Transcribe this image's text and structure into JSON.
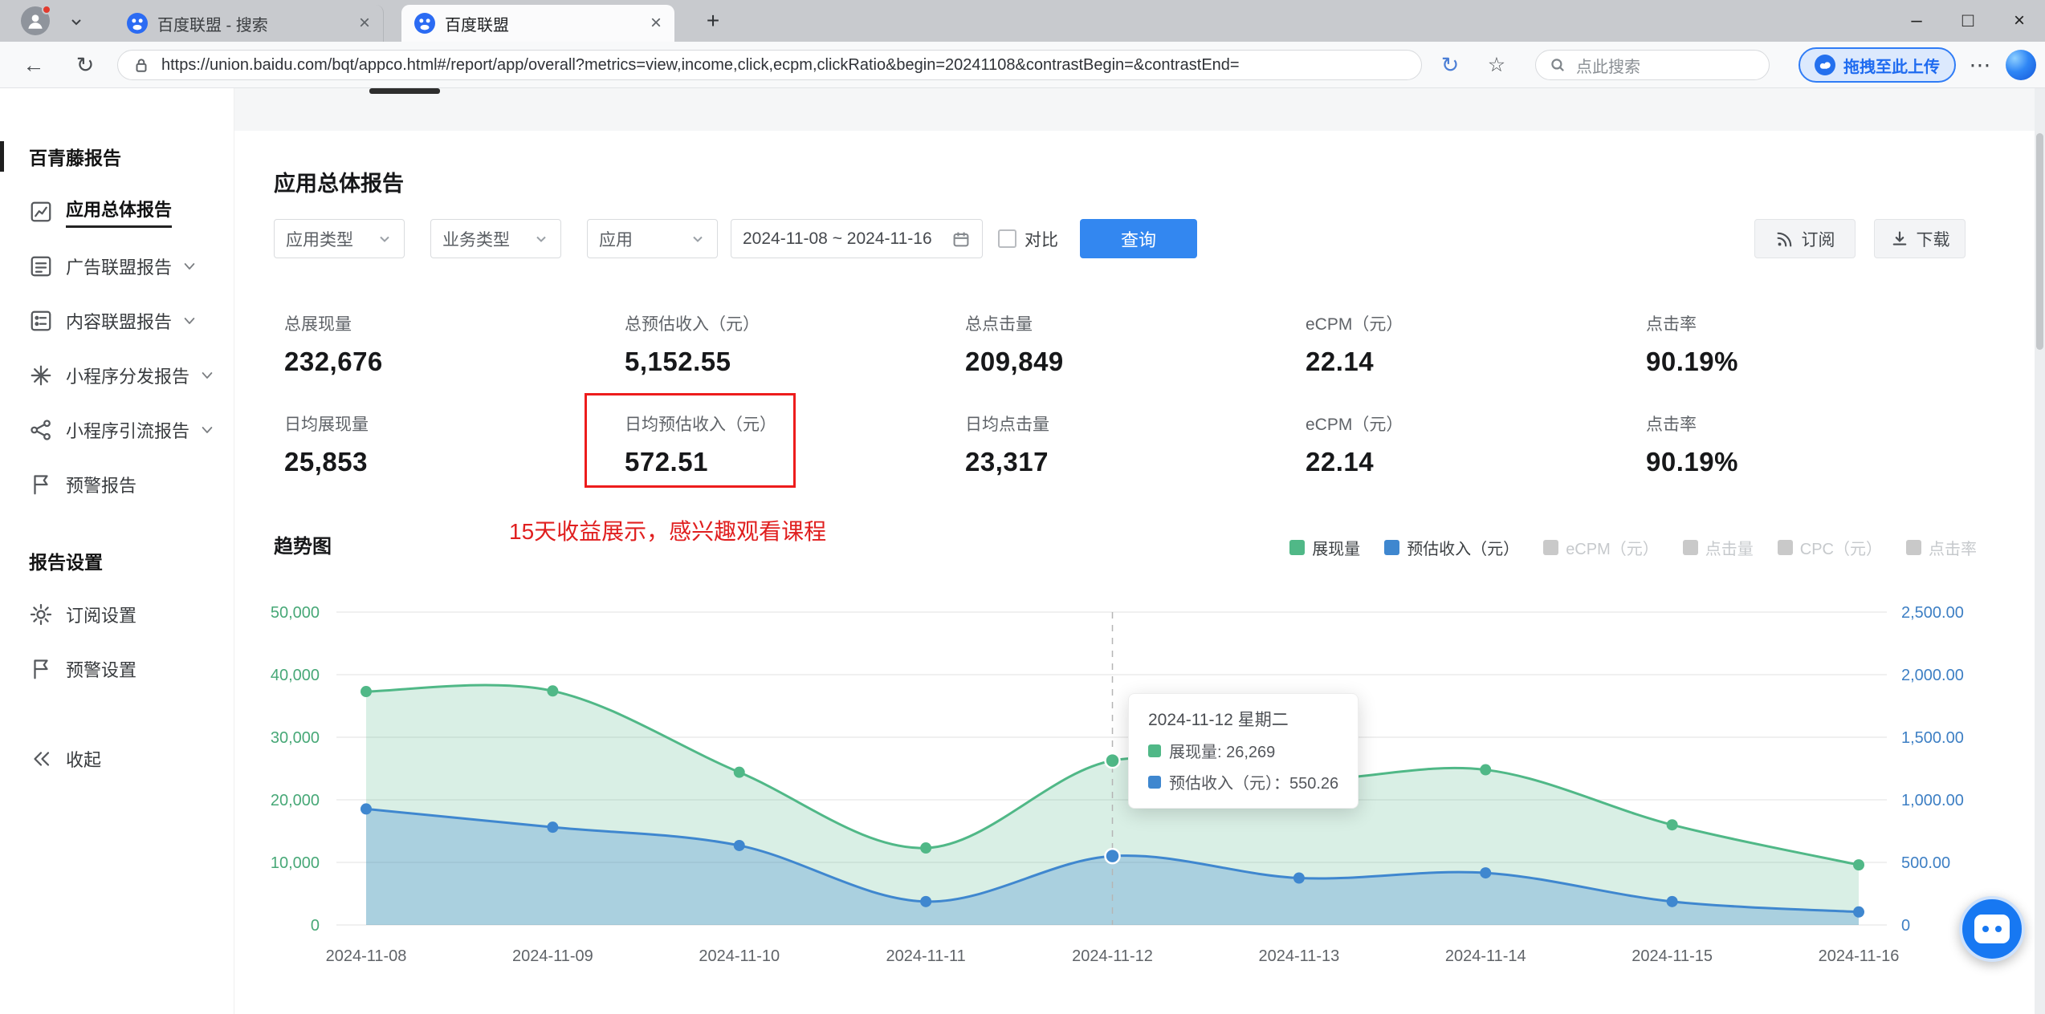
{
  "colors": {
    "accent_blue": "#3387f0",
    "highlight_red": "#ed1c1c",
    "series_green": "#50b887",
    "series_blue": "#3f87cf",
    "axis_green": "#47a877",
    "axis_blue": "#3d7fc4",
    "legend_inactive": "#c9c9c9"
  },
  "icons": {
    "back_arrow": "←",
    "refresh": "↻",
    "page_action": "↻",
    "star": "☆",
    "more_dots": "⋯",
    "new_tab": "+",
    "tab_close": "×",
    "window_minimize": "–",
    "window_maximize": "□",
    "window_close": "×"
  },
  "browser": {
    "tabs": [
      {
        "title": "百度联盟 - 搜索",
        "active": false
      },
      {
        "title": "百度联盟",
        "active": true
      }
    ],
    "url": "https://union.baidu.com/bqt/appco.html#/report/app/overall?metrics=view,income,click,ecpm,clickRatio&begin=20241108&contrastBegin=&contrastEnd=",
    "search_placeholder": "点此搜索",
    "upload_button_label": "拖拽至此上传"
  },
  "sidebar": {
    "section1_title": "百青藤报告",
    "menu": [
      {
        "id": "overall-report",
        "label": "应用总体报告",
        "icon": "report-chart",
        "active": true,
        "expandable": false
      },
      {
        "id": "ad-union-report",
        "label": "广告联盟报告",
        "icon": "ad-doc",
        "active": false,
        "expandable": true
      },
      {
        "id": "content-union-report",
        "label": "内容联盟报告",
        "icon": "content-doc",
        "active": false,
        "expandable": true
      },
      {
        "id": "miniapp-distribution-report",
        "label": "小程序分发报告",
        "icon": "grid-burst",
        "active": false,
        "expandable": true
      },
      {
        "id": "miniapp-referral-report",
        "label": "小程序引流报告",
        "icon": "share-nodes",
        "active": false,
        "expandable": true
      },
      {
        "id": "alert-report",
        "label": "预警报告",
        "icon": "flag-doc",
        "active": false,
        "expandable": false
      }
    ],
    "section2_title": "报告设置",
    "settings_menu": [
      {
        "id": "subscribe-settings",
        "label": "订阅设置",
        "icon": "gear"
      },
      {
        "id": "alert-settings",
        "label": "预警设置",
        "icon": "flag-doc"
      }
    ],
    "collapse_label": "收起"
  },
  "main": {
    "title": "应用总体报告",
    "filters": {
      "app_type": "应用类型",
      "business_type": "业务类型",
      "app": "应用",
      "date_range": "2024-11-08 ~ 2024-11-16",
      "compare_label": "对比",
      "query_button": "查询",
      "subscribe_button": "订阅",
      "download_button": "下载"
    },
    "stats_row1": [
      {
        "label": "总展现量",
        "value": "232,676"
      },
      {
        "label": "总预估收入（元）",
        "value": "5,152.55"
      },
      {
        "label": "总点击量",
        "value": "209,849"
      },
      {
        "label": "eCPM（元）",
        "value": "22.14"
      },
      {
        "label": "点击率",
        "value": "90.19%"
      }
    ],
    "stats_row2": [
      {
        "label": "日均展现量",
        "value": "25,853"
      },
      {
        "label": "日均预估收入（元）",
        "value": "572.51",
        "highlighted": true
      },
      {
        "label": "日均点击量",
        "value": "23,317"
      },
      {
        "label": "eCPM（元）",
        "value": "22.14"
      },
      {
        "label": "点击率",
        "value": "90.19%"
      }
    ],
    "annotation": "15天收益展示，感兴趣观看课程",
    "chart_title": "趋势图"
  },
  "chart_data": {
    "type": "area",
    "title": "趋势图",
    "x": [
      "2024-11-08",
      "2024-11-09",
      "2024-11-10",
      "2024-11-11",
      "2024-11-12",
      "2024-11-13",
      "2024-11-14",
      "2024-11-15",
      "2024-11-16"
    ],
    "series": [
      {
        "name": "展现量",
        "axis": "left",
        "color": "#50b887",
        "fill": "rgba(80,184,135,0.22)",
        "values": [
          37300,
          37400,
          24400,
          12300,
          26269,
          23200,
          24800,
          16000,
          9600
        ]
      },
      {
        "name": "预估收入（元）",
        "axis": "right",
        "color": "#3f87cf",
        "fill": "rgba(63,135,207,0.30)",
        "values": [
          927,
          781,
          635,
          187,
          550.26,
          375,
          416,
          187,
          104
        ]
      }
    ],
    "left_axis": {
      "min": 0,
      "max": 50000,
      "ticks": [
        "0",
        "10,000",
        "20,000",
        "30,000",
        "40,000",
        "50,000"
      ]
    },
    "right_axis": {
      "min": 0,
      "max": 2500,
      "ticks": [
        "0",
        "500.00",
        "1,000.00",
        "1,500.00",
        "2,000.00",
        "2,500.00"
      ]
    },
    "legend": [
      {
        "label": "展现量",
        "color": "#50b887",
        "active": true
      },
      {
        "label": "预估收入（元）",
        "color": "#3f87cf",
        "active": true
      },
      {
        "label": "eCPM（元）",
        "color": "#c9c9c9",
        "active": false
      },
      {
        "label": "点击量",
        "color": "#c9c9c9",
        "active": false
      },
      {
        "label": "CPC（元）",
        "color": "#c9c9c9",
        "active": false
      },
      {
        "label": "点击率",
        "color": "#c9c9c9",
        "active": false
      }
    ],
    "legend_position": "top-right",
    "grid": true,
    "hover_index": 4,
    "tooltip": {
      "title": "2024-11-12 星期二",
      "rows": [
        {
          "marker_color": "#50b887",
          "text": "展现量: 26,269"
        },
        {
          "marker_color": "#3f87cf",
          "text": "预估收入（元）：550.26"
        }
      ]
    }
  }
}
